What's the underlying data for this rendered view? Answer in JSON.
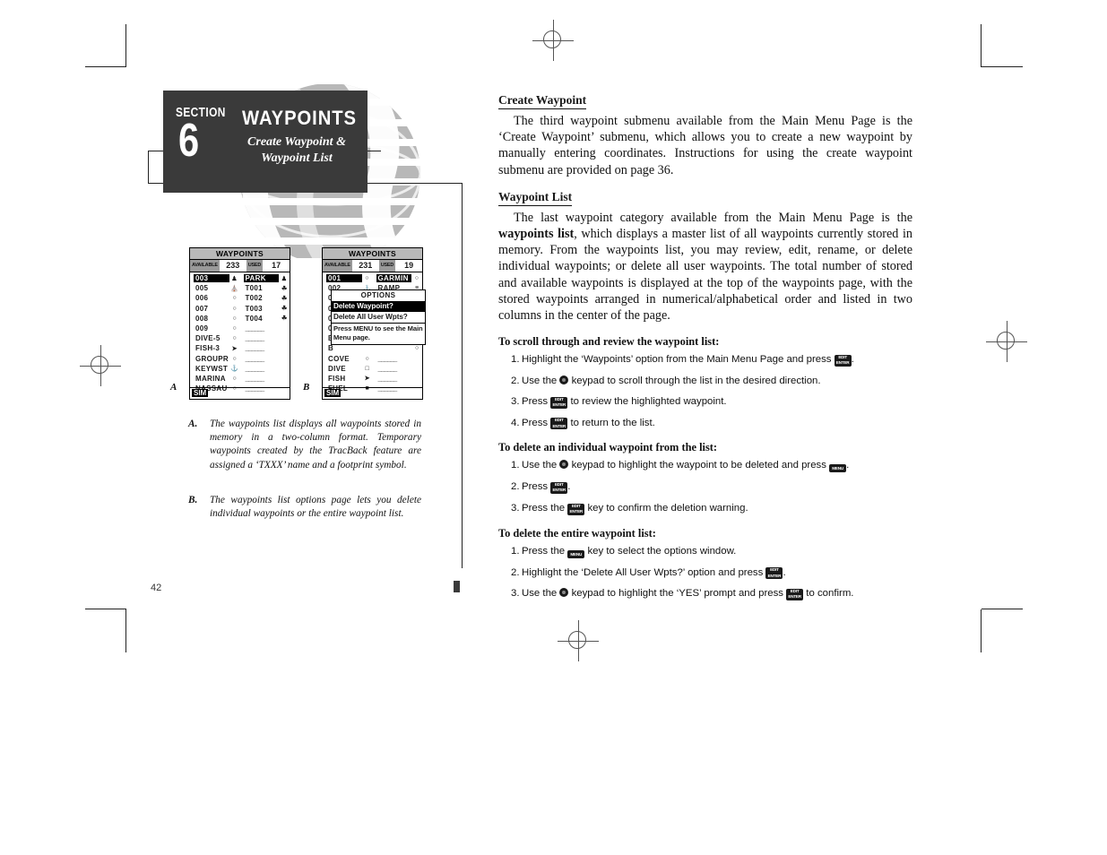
{
  "page": {
    "folio": "42"
  },
  "section_header": {
    "section_word": "SECTION",
    "section_number": "6",
    "title": "WAYPOINTS",
    "subtitle": "Create Waypoint & Waypoint List"
  },
  "figures": {
    "a": {
      "letter": "A",
      "title": "WAYPOINTS",
      "available_label": "AVAILABLE",
      "available_value": "233",
      "used_label": "USED",
      "used_value": "17",
      "footer": "SIM",
      "rows": [
        {
          "left_name": "003",
          "left_symbol": "♟",
          "right_name": "PARK",
          "right_symbol": "♟",
          "selected": true
        },
        {
          "left_name": "005",
          "left_symbol": "⛪",
          "right_name": "T001",
          "right_symbol": "☘",
          "selected": false
        },
        {
          "left_name": "006",
          "left_symbol": "○",
          "right_name": "T002",
          "right_symbol": "☘",
          "selected": false
        },
        {
          "left_name": "007",
          "left_symbol": "○",
          "right_name": "T003",
          "right_symbol": "☘",
          "selected": false
        },
        {
          "left_name": "008",
          "left_symbol": "○",
          "right_name": "T004",
          "right_symbol": "☘",
          "selected": false
        },
        {
          "left_name": "009",
          "left_symbol": "○",
          "right_name": "______",
          "right_symbol": "",
          "selected": false
        },
        {
          "left_name": "DIVE-5",
          "left_symbol": "○",
          "right_name": "______",
          "right_symbol": "",
          "selected": false
        },
        {
          "left_name": "FISH-3",
          "left_symbol": "➤",
          "right_name": "______",
          "right_symbol": "",
          "selected": false
        },
        {
          "left_name": "GROUPR",
          "left_symbol": "○",
          "right_name": "______",
          "right_symbol": "",
          "selected": false
        },
        {
          "left_name": "KEYWST",
          "left_symbol": "⚓",
          "right_name": "______",
          "right_symbol": "",
          "selected": false
        },
        {
          "left_name": "MARINA",
          "left_symbol": "○",
          "right_name": "______",
          "right_symbol": "",
          "selected": false
        },
        {
          "left_name": "NASSAU",
          "left_symbol": "○",
          "right_name": "______",
          "right_symbol": "",
          "selected": false
        }
      ]
    },
    "b": {
      "letter": "B",
      "title": "WAYPOINTS",
      "available_label": "AVAILABLE",
      "available_value": "231",
      "used_label": "USED",
      "used_value": "19",
      "footer": "SIM",
      "rows": [
        {
          "left_name": "001",
          "left_symbol": "○",
          "right_name": "GARMIN",
          "right_symbol": "○",
          "selected": true
        },
        {
          "left_name": "002",
          "left_symbol": "⚓",
          "right_name": "RAMP",
          "right_symbol": "≡",
          "selected": false
        },
        {
          "left_name": "0",
          "left_symbol": "",
          "right_name": "",
          "right_symbol": "○",
          "selected": false
        },
        {
          "left_name": "0",
          "left_symbol": "",
          "right_name": "",
          "right_symbol": "○",
          "selected": false
        },
        {
          "left_name": "0",
          "left_symbol": "",
          "right_name": "",
          "right_symbol": "○",
          "selected": false
        },
        {
          "left_name": "0",
          "left_symbol": "",
          "right_name": "",
          "right_symbol": "○",
          "selected": false
        },
        {
          "left_name": "B",
          "left_symbol": "",
          "right_name": "",
          "right_symbol": "○",
          "selected": false
        },
        {
          "left_name": "B",
          "left_symbol": "",
          "right_name": "",
          "right_symbol": "○",
          "selected": false
        },
        {
          "left_name": "COVE",
          "left_symbol": "○",
          "right_name": "______",
          "right_symbol": "",
          "selected": false
        },
        {
          "left_name": "DIVE",
          "left_symbol": "□",
          "right_name": "______",
          "right_symbol": "",
          "selected": false
        },
        {
          "left_name": "FISH",
          "left_symbol": "➤",
          "right_name": "______",
          "right_symbol": "",
          "selected": false
        },
        {
          "left_name": "FUEL",
          "left_symbol": "■",
          "right_name": "______",
          "right_symbol": "",
          "selected": false
        }
      ],
      "options": {
        "header": "OPTIONS",
        "items": [
          {
            "label": "Delete Waypoint?",
            "selected": true
          },
          {
            "label": "Delete All User Wpts?",
            "selected": false
          }
        ],
        "note": "Press MENU to see the Main Menu page."
      }
    }
  },
  "captions": [
    {
      "tag": "A.",
      "text": "The waypoints list displays all waypoints stored in memory in a two-column format. Temporary waypoints created by the TracBack feature are assigned a ‘TXXX’ name and a footprint symbol."
    },
    {
      "tag": "B.",
      "text": "The waypoints list options page lets you delete individual waypoints or the entire waypoint list."
    }
  ],
  "body": {
    "heading_create": "Create Waypoint",
    "para_create": "The third waypoint submenu available from the Main Menu Page is the ‘Create Waypoint’ submenu, which allows you to create a new waypoint by manually entering coordinates. Instructions for using the create waypoint submenu are provided on page 36.",
    "heading_list": "Waypoint List",
    "para_list_1": "The last waypoint category available from the Main Menu Page is the ",
    "para_list_bold_1": "waypoints list",
    "para_list_2": ", which displays a master list of all waypoints currently stored in memory. From the waypoints list, you may review, edit, rename, or delete individual waypoints; or delete all user waypoints. The total number of stored and available waypoints is displayed at the top of the waypoints page, with the stored waypoints arranged in numerical/alphabetical order and listed in two columns in the center of the page."
  },
  "procedures": [
    {
      "title": "To scroll through and review the waypoint list:",
      "steps": [
        {
          "num": "1.",
          "before": "Highlight the ‘Waypoints’ option from the Main Menu Page and press ",
          "key": "enter",
          "after": "."
        },
        {
          "num": "2.",
          "before": "Use the ",
          "key": "rocker",
          "after": " keypad to scroll through the list in the desired direction."
        },
        {
          "num": "3.",
          "before": "Press ",
          "key": "enter",
          "after": " to review the highlighted waypoint."
        },
        {
          "num": "4.",
          "before": "Press ",
          "key": "enter",
          "after": " to return to the list."
        }
      ]
    },
    {
      "title": "To delete an individual waypoint from the list:",
      "steps": [
        {
          "num": "1.",
          "before": "Use the ",
          "key": "rocker",
          "mid": " keypad to highlight the waypoint to be deleted and press ",
          "key2": "menu",
          "after": "."
        },
        {
          "num": "2.",
          "before": "Press ",
          "key": "enter",
          "after": "."
        },
        {
          "num": "3.",
          "before": "Press the ",
          "key": "enter",
          "after": " key to confirm the deletion warning."
        }
      ]
    },
    {
      "title": "To delete the entire waypoint list:",
      "steps": [
        {
          "num": "1.",
          "before": "Press the ",
          "key": "menu",
          "after": " key to select the options window."
        },
        {
          "num": "2.",
          "before": "Highlight the ‘Delete All User Wpts?’ option and press ",
          "key": "enter",
          "after": "."
        },
        {
          "num": "3.",
          "before": "Use the ",
          "key": "rocker",
          "mid": " keypad to highlight the ‘YES’ prompt and press ",
          "key2": "enter",
          "after": " to confirm."
        }
      ]
    }
  ],
  "keys": {
    "enter_line1": "EDIT",
    "enter_line2": "ENTER",
    "menu_label": "MENU"
  },
  "colors": {
    "header_bg": "#3a3a3a",
    "watermark": "#b8b8b8",
    "screen_title_bg": "#b9b9b9",
    "screen_label_bg": "#9a9a9a"
  }
}
